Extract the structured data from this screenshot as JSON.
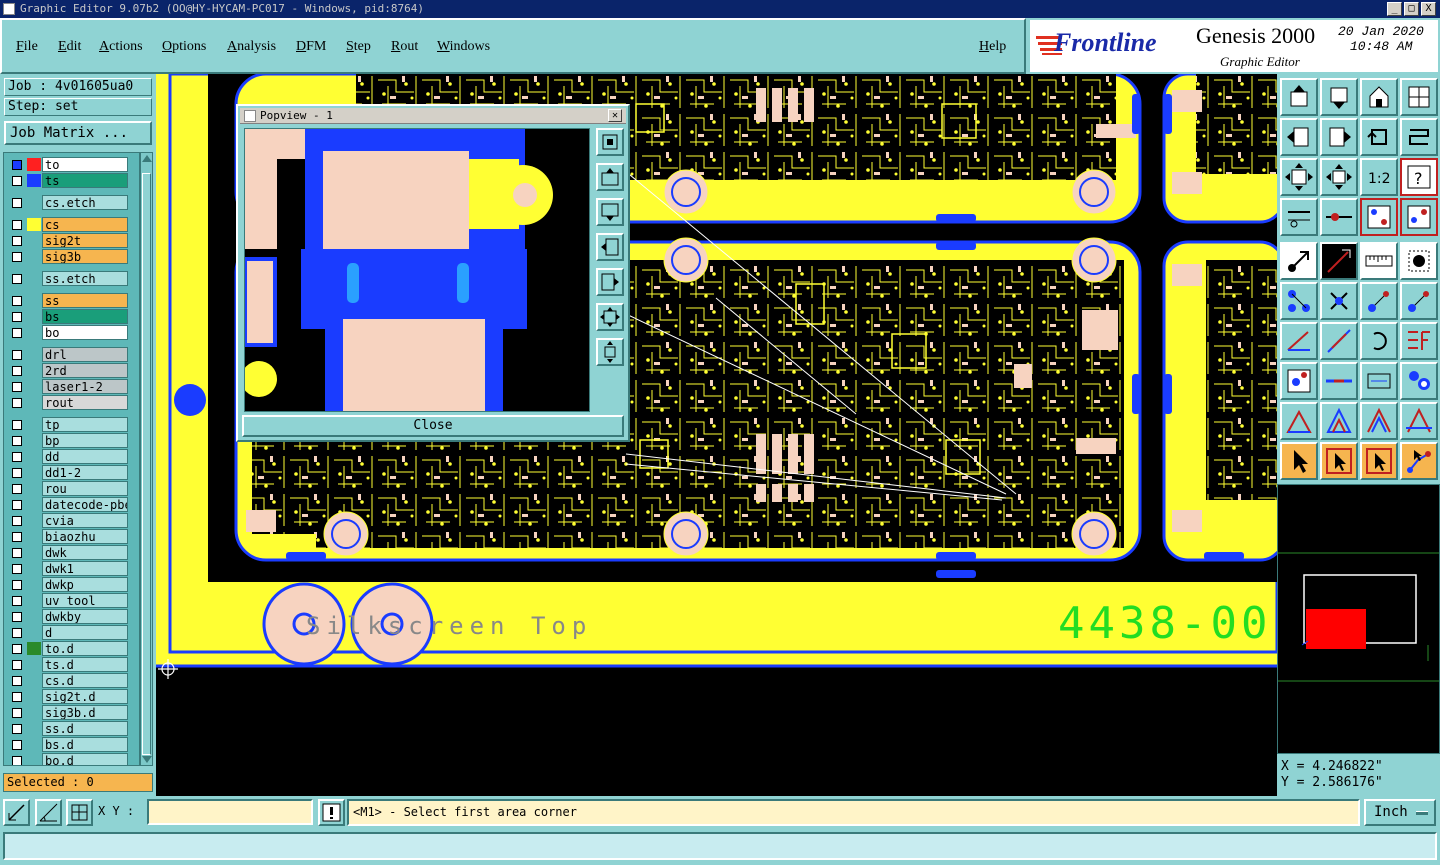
{
  "window": {
    "title": "Graphic Editor 9.07b2 (OO@HY-HYCAM-PC017 - Windows, pid:8764)",
    "buttons": [
      "_",
      "□",
      "X"
    ]
  },
  "menu": [
    "File",
    "Edit",
    "Actions",
    "Options",
    "Analysis",
    "DFM",
    "Step",
    "Rout",
    "Windows"
  ],
  "help_label": "Help",
  "brand": {
    "logo": "Frontline",
    "product": "Genesis 2000",
    "subtitle": "Graphic Editor",
    "date": "20 Jan 2020",
    "time": "10:48 AM"
  },
  "job": {
    "job_label": "Job : 4v01605ua0",
    "step_label": "Step: set",
    "matrix_button": "Job Matrix ..."
  },
  "layers": [
    {
      "name": "to",
      "color": "#ffffff",
      "swatch": "#ff2020",
      "state": "work"
    },
    {
      "name": "ts",
      "color": "#1a9e7a",
      "swatch": "#1a3cff"
    },
    {
      "name": "cs.etch",
      "color": "#a9dede",
      "swatch": ""
    },
    {
      "name": "cs",
      "color": "#f6b54f",
      "swatch": "#ffff33"
    },
    {
      "name": "sig2t",
      "color": "#f6b54f",
      "swatch": ""
    },
    {
      "name": "sig3b",
      "color": "#f6b54f",
      "swatch": ""
    },
    {
      "name": "ss.etch",
      "color": "#a9dede",
      "swatch": ""
    },
    {
      "name": "ss",
      "color": "#f6b54f",
      "swatch": ""
    },
    {
      "name": "bs",
      "color": "#1a9e7a",
      "swatch": ""
    },
    {
      "name": "bo",
      "color": "#ffffff",
      "swatch": ""
    },
    {
      "name": "drl",
      "color": "#bcc6c8",
      "swatch": ""
    },
    {
      "name": "2rd",
      "color": "#bcc6c8",
      "swatch": ""
    },
    {
      "name": "laser1-2",
      "color": "#bcc6c8",
      "swatch": ""
    },
    {
      "name": "rout",
      "color": "#d8d8d8",
      "swatch": ""
    },
    {
      "name": "tp",
      "color": "#a9dede",
      "swatch": ""
    },
    {
      "name": "bp",
      "color": "#a9dede",
      "swatch": ""
    },
    {
      "name": "dd",
      "color": "#a9dede",
      "swatch": ""
    },
    {
      "name": "dd1-2",
      "color": "#a9dede",
      "swatch": ""
    },
    {
      "name": "rou",
      "color": "#a9dede",
      "swatch": ""
    },
    {
      "name": "datecode-pbe",
      "color": "#a9dede",
      "swatch": ""
    },
    {
      "name": "cvia",
      "color": "#a9dede",
      "swatch": ""
    },
    {
      "name": "biaozhu",
      "color": "#a9dede",
      "swatch": ""
    },
    {
      "name": "dwk",
      "color": "#a9dede",
      "swatch": ""
    },
    {
      "name": "dwk1",
      "color": "#a9dede",
      "swatch": ""
    },
    {
      "name": "dwkp",
      "color": "#a9dede",
      "swatch": ""
    },
    {
      "name": "uv_tool",
      "color": "#a9dede",
      "swatch": ""
    },
    {
      "name": "dwkby",
      "color": "#a9dede",
      "swatch": ""
    },
    {
      "name": "d",
      "color": "#a9dede",
      "swatch": ""
    },
    {
      "name": "to.d",
      "color": "#a9dede",
      "swatch": "#2a8a2a"
    },
    {
      "name": "ts.d",
      "color": "#a9dede",
      "swatch": ""
    },
    {
      "name": "cs.d",
      "color": "#a9dede",
      "swatch": ""
    },
    {
      "name": "sig2t.d",
      "color": "#a9dede",
      "swatch": ""
    },
    {
      "name": "sig3b.d",
      "color": "#a9dede",
      "swatch": ""
    },
    {
      "name": "ss.d",
      "color": "#a9dede",
      "swatch": ""
    },
    {
      "name": "bs.d",
      "color": "#a9dede",
      "swatch": ""
    },
    {
      "name": "bo.d",
      "color": "#a9dede",
      "swatch": ""
    }
  ],
  "selected_label": "Selected : 0",
  "popview": {
    "title": "Popview - 1",
    "close_label": "Close"
  },
  "canvas": {
    "silkscreen_text": "Silkscreen Top",
    "part_number": "4438-00"
  },
  "coords": {
    "x": "X = 4.246822\"",
    "y": "Y = 2.586176\""
  },
  "status": {
    "xy_label": "X Y :",
    "prompt": "<M1> - Select first area corner",
    "units": "Inch"
  },
  "colors": {
    "panel": "#8fd3d3",
    "copper": "#ffff33",
    "pad": "#f7d3c0",
    "mask": "#1a3cff",
    "accent_orange": "#f6b54f",
    "silk_green": "#22dd22"
  }
}
